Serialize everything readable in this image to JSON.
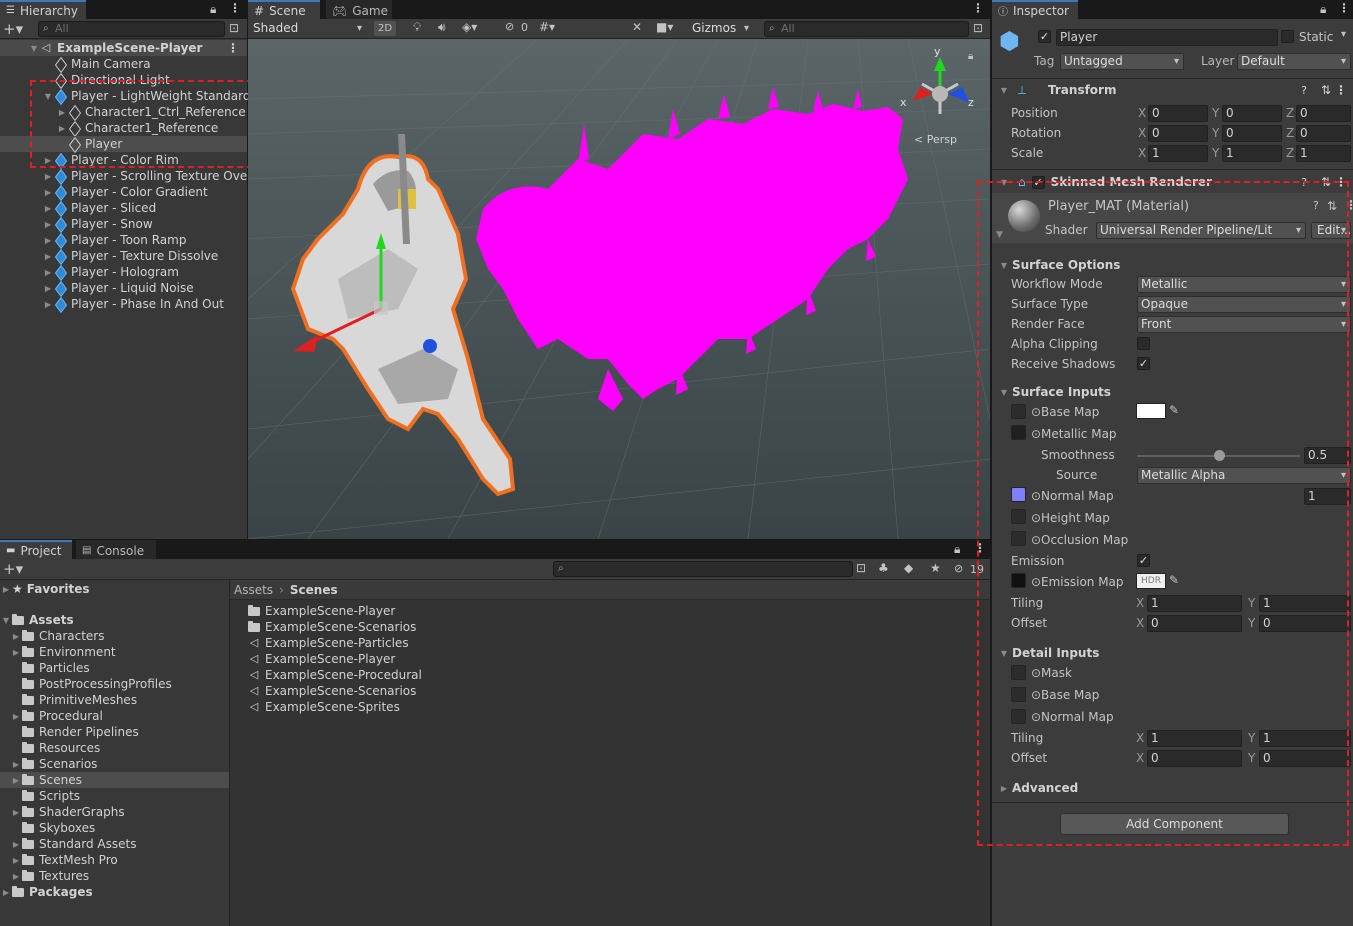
{
  "hierarchy": {
    "tab_label": "Hierarchy",
    "search_placeholder": "All",
    "scene_name": "ExampleScene-Player",
    "items": [
      {
        "label": "Main Camera"
      },
      {
        "label": "Directional Light"
      },
      {
        "label": "Player - LightWeight Standard"
      },
      {
        "label": "Character1_Ctrl_Reference"
      },
      {
        "label": "Character1_Reference"
      },
      {
        "label": "Player"
      },
      {
        "label": "Player - Color Rim"
      },
      {
        "label": "Player - Scrolling Texture Over"
      },
      {
        "label": "Player - Color Gradient"
      },
      {
        "label": "Player - Sliced"
      },
      {
        "label": "Player - Snow"
      },
      {
        "label": "Player - Toon Ramp"
      },
      {
        "label": "Player - Texture Dissolve"
      },
      {
        "label": "Player - Hologram"
      },
      {
        "label": "Player - Liquid Noise"
      },
      {
        "label": "Player - Phase In And Out"
      }
    ]
  },
  "scene": {
    "tab_scene": "Scene",
    "tab_game": "Game",
    "shading_mode": "Shaded",
    "mode_2d": "2D",
    "hidden_count": "0",
    "gizmos_label": "Gizmos",
    "search_placeholder": "All",
    "axis_y": "y",
    "axis_x": "x",
    "axis_z": "z",
    "persp_label": "< Persp"
  },
  "project": {
    "tab_project": "Project",
    "tab_console": "Console",
    "hidden_count": "19",
    "favorites_label": "Favorites",
    "assets_label": "Assets",
    "packages_label": "Packages",
    "folders": [
      {
        "label": "Characters"
      },
      {
        "label": "Environment"
      },
      {
        "label": "Particles"
      },
      {
        "label": "PostProcessingProfiles"
      },
      {
        "label": "PrimitiveMeshes"
      },
      {
        "label": "Procedural"
      },
      {
        "label": "Render Pipelines"
      },
      {
        "label": "Resources"
      },
      {
        "label": "Scenarios"
      },
      {
        "label": "Scenes"
      },
      {
        "label": "Scripts"
      },
      {
        "label": "ShaderGraphs"
      },
      {
        "label": "Skyboxes"
      },
      {
        "label": "Standard Assets"
      },
      {
        "label": "TextMesh Pro"
      },
      {
        "label": "Textures"
      }
    ],
    "breadcrumb_root": "Assets",
    "breadcrumb_current": "Scenes",
    "files": [
      {
        "label": "ExampleScene-Player",
        "kind": "folder"
      },
      {
        "label": "ExampleScene-Scenarios",
        "kind": "folder"
      },
      {
        "label": "ExampleScene-Particles",
        "kind": "scene"
      },
      {
        "label": "ExampleScene-Player",
        "kind": "scene"
      },
      {
        "label": "ExampleScene-Procedural",
        "kind": "scene"
      },
      {
        "label": "ExampleScene-Scenarios",
        "kind": "scene"
      },
      {
        "label": "ExampleScene-Sprites",
        "kind": "scene"
      }
    ]
  },
  "inspector": {
    "tab_label": "Inspector",
    "object_name": "Player",
    "static_label": "Static",
    "tag_label": "Tag",
    "tag_value": "Untagged",
    "layer_label": "Layer",
    "layer_value": "Default",
    "transform": {
      "title": "Transform",
      "position_label": "Position",
      "rotation_label": "Rotation",
      "scale_label": "Scale",
      "x": "X",
      "y": "Y",
      "z": "Z",
      "position": [
        "0",
        "0",
        "0"
      ],
      "rotation": [
        "0",
        "0",
        "0"
      ],
      "scale": [
        "1",
        "1",
        "1"
      ]
    },
    "smr_title": "Skinned Mesh Renderer",
    "material": {
      "name": "Player_MAT (Material)",
      "shader_label": "Shader",
      "shader_value": "Universal Render Pipeline/Lit",
      "edit_label": "Edit..."
    },
    "surface_options": {
      "title": "Surface Options",
      "workflow_label": "Workflow Mode",
      "workflow_value": "Metallic",
      "surface_type_label": "Surface Type",
      "surface_type_value": "Opaque",
      "render_face_label": "Render Face",
      "render_face_value": "Front",
      "alpha_clipping_label": "Alpha Clipping",
      "receive_shadows_label": "Receive Shadows",
      "receive_shadows_check": "✓"
    },
    "surface_inputs": {
      "title": "Surface Inputs",
      "base_map_label": "Base Map",
      "metallic_map_label": "Metallic Map",
      "smoothness_label": "Smoothness",
      "smoothness_value": "0.5",
      "smoothness": 0.5,
      "source_label": "Source",
      "source_value": "Metallic Alpha",
      "normal_map_label": "Normal Map",
      "normal_value": "1",
      "height_map_label": "Height Map",
      "occlusion_map_label": "Occlusion Map",
      "emission_label": "Emission",
      "emission_check": "✓",
      "emission_map_label": "Emission Map",
      "hdr_label": "HDR",
      "tiling_label": "Tiling",
      "offset_label": "Offset",
      "x": "X",
      "y": "Y",
      "tiling": [
        "1",
        "1"
      ],
      "offset": [
        "0",
        "0"
      ]
    },
    "detail_inputs": {
      "title": "Detail Inputs",
      "mask_label": "Mask",
      "base_map_label": "Base Map",
      "normal_map_label": "Normal Map",
      "tiling_label": "Tiling",
      "offset_label": "Offset",
      "x": "X",
      "y": "Y",
      "tiling": [
        "1",
        "1"
      ],
      "offset": [
        "0",
        "0"
      ]
    },
    "advanced_title": "Advanced",
    "add_component_label": "Add Component"
  },
  "colors": {
    "accent_tab": "#3a79bb",
    "selection": "#2c5d87",
    "highlight_magenta": "#ff00ff",
    "selection_outline": "#f07020",
    "annotation_dash": "#e02020"
  }
}
